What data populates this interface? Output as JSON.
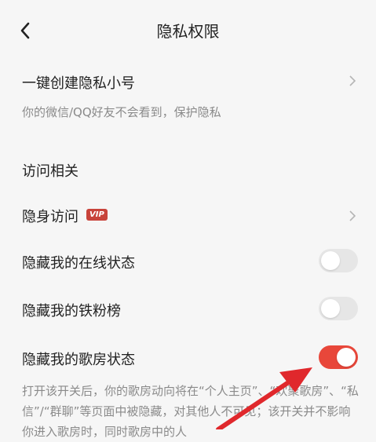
{
  "header": {
    "title": "隐私权限"
  },
  "alt_account": {
    "label": "一键创建隐私小号",
    "hint": "你的微信/QQ好友不会看到，保护隐私"
  },
  "section": {
    "title": "访问相关"
  },
  "rows": {
    "stealth_visit": {
      "label": "隐身访问",
      "badge": "VIP"
    },
    "hide_online": {
      "label": "隐藏我的在线状态",
      "on": false
    },
    "hide_fans": {
      "label": "隐藏我的铁粉榜",
      "on": false
    },
    "hide_room": {
      "label": "隐藏我的歌房状态",
      "on": true
    }
  },
  "description": "打开该开关后，你的歌房动向将在“个人主页”、“欢聚歌房”、“私信”/“群聊”等页面中被隐藏，对其他人不可见；该开关并不影响你进入歌房时，同时歌房中的人",
  "colors": {
    "accent": "#e8473a",
    "toggle_off": "#e6e6e6",
    "arrow": "#e0282c"
  }
}
